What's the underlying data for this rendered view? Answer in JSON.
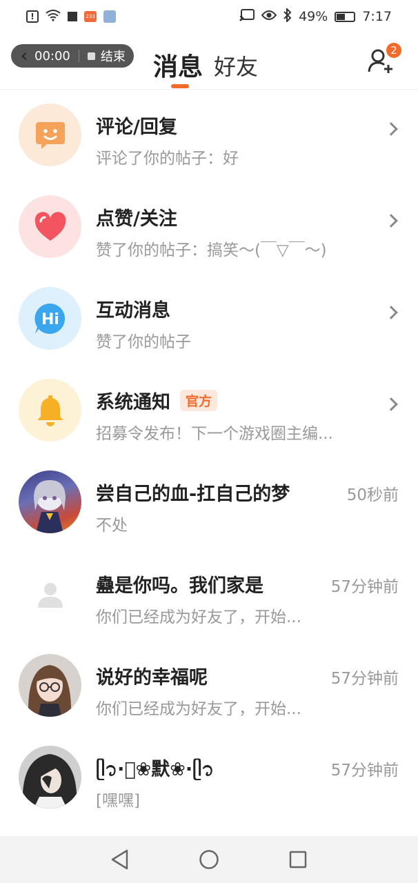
{
  "status_bar": {
    "battery_percent": "49%",
    "time": "7:17",
    "app_icon_text": "233"
  },
  "header": {
    "recording": {
      "timer": "00:00",
      "stop_label": "结束"
    },
    "tabs": [
      {
        "label": "消息",
        "active": true
      },
      {
        "label": "好友",
        "active": false
      }
    ],
    "friend_request_badge": "2"
  },
  "system_rows": [
    {
      "title": "评论/回复",
      "subtitle": "评论了你的帖子：好",
      "icon": "comment-icon",
      "color": "#f5a25a",
      "bg": "#fde9d7"
    },
    {
      "title": "点赞/关注",
      "subtitle": "赞了你的帖子：搞笑～(￣▽￣～)",
      "icon": "heart-icon",
      "color": "#f25560",
      "bg": "#fde2e2"
    },
    {
      "title": "互动消息",
      "subtitle": "赞了你的帖子",
      "icon": "hi-icon",
      "color": "#39a6ee",
      "bg": "#ddf0fc"
    },
    {
      "title": "系统通知",
      "tag": "官方",
      "subtitle": "招募令发布！下一个游戏圈主编...",
      "icon": "bell-icon",
      "color": "#f7b026",
      "bg": "#fdf1d6"
    }
  ],
  "chats": [
    {
      "name": "尝自己的血-扛自己的梦",
      "time": "50秒前",
      "preview": " 不处"
    },
    {
      "name": "蠱是你吗。我们家是",
      "time": "57分钟前",
      "preview": "你们已经成为好友了，开始..."
    },
    {
      "name": "说好的幸福呢",
      "time": "57分钟前",
      "preview": "你们已经成为好友了，开始..."
    },
    {
      "name": "ᥫ᭡·⃝❀默❀·ᥫ᭡",
      "time": "57分钟前",
      "preview": "[嘿嘿]"
    }
  ]
}
